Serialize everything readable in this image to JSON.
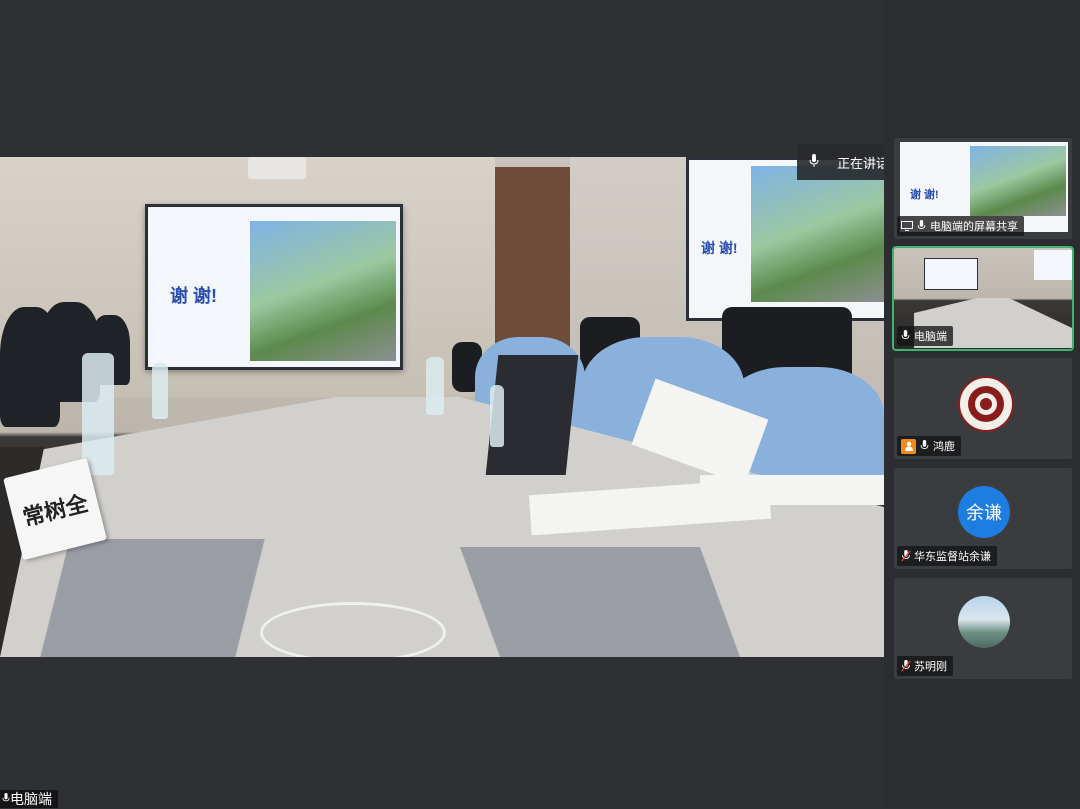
{
  "main": {
    "speaking_label": "正在讲话: 电脑端;",
    "stream_label": "电脑端",
    "nameplate_text": "常树全",
    "slide_text": "谢 谢!"
  },
  "sidebar": {
    "tiles": [
      {
        "label": "电脑端的屏幕共享",
        "kind": "screen-share"
      },
      {
        "label": "电脑端",
        "kind": "video",
        "active": true
      },
      {
        "label": "鸿鹿",
        "kind": "avatar-logo"
      },
      {
        "label": "华东监督站余谦",
        "kind": "avatar-text",
        "avatar_text": "余谦",
        "avatar_color": "#1e7de0",
        "muted": true
      },
      {
        "label": "苏明刚",
        "kind": "avatar-photo",
        "muted": true
      }
    ]
  },
  "colors": {
    "background": "#2e3034",
    "sidebar": "#2b2d31",
    "active_border": "#3fb46f",
    "avatar_blue": "#1e7de0"
  }
}
